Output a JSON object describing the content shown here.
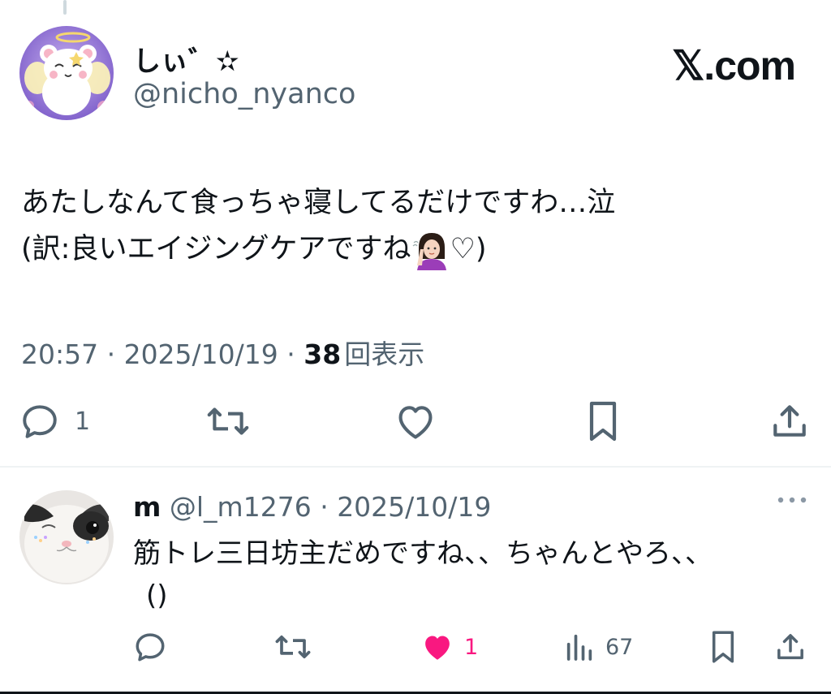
{
  "post": {
    "author_name": "しぃ゛✫",
    "handle": "@nicho_nyanco",
    "brand": "𝕏.com",
    "text_line1": "あたしなんて食っちゃ寝してるだけですわ…泣",
    "text_line2_a": "(訳:良いエイジングケアですね",
    "text_line2_b": "♡)",
    "timestamp": "20:57 · 2025/10/19 · ",
    "views": "38",
    "views_label": "回表示",
    "reply_count": "1",
    "retweet_count": "",
    "like_count": "",
    "emoji": "woman-tipping-hand-emoji"
  },
  "reply": {
    "name": "m",
    "handle": "@l_m1276",
    "separator": "·",
    "date": "2025/10/19",
    "text_line1": "筋トレ三日坊主だめですね、、ちゃんとやろ、、",
    "text_line2": "()",
    "like_count": "1",
    "views_count": "67",
    "liked": true
  },
  "colors": {
    "text": "#0f1419",
    "secondary": "#536471",
    "like": "#f91880",
    "divider": "#eff3f4"
  },
  "icons": [
    "reply-icon",
    "retweet-icon",
    "like-icon",
    "bookmark-icon",
    "share-icon",
    "views-icon",
    "more-icon"
  ]
}
